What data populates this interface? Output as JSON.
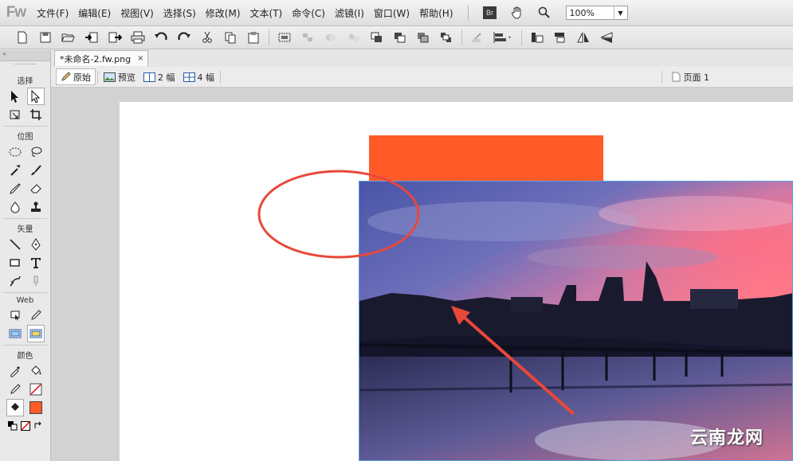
{
  "app": {
    "logo": "Fw"
  },
  "menu": [
    "文件(F)",
    "编辑(E)",
    "视图(V)",
    "选择(S)",
    "修改(M)",
    "文本(T)",
    "命令(C)",
    "滤镜(I)",
    "窗口(W)",
    "帮助(H)"
  ],
  "menubar_icons": {
    "bridge_label": "Br",
    "hand": "hand-icon",
    "zoom": "zoom-icon"
  },
  "zoom_value": "100%",
  "document": {
    "tab_title": "*未命名-2.fw.png",
    "close": "×"
  },
  "view_modes": [
    "原始",
    "预览",
    "2 幅",
    "4 幅"
  ],
  "page_indicator": "页面 1",
  "tools": {
    "sections": [
      "选择",
      "位图",
      "矢量",
      "Web",
      "颜色"
    ]
  },
  "colors": {
    "accent_orange": "#ff5a27",
    "annotation_red": "#e8483a",
    "fill_swatch": "#ff5a27"
  },
  "watermark": "云南龙网"
}
